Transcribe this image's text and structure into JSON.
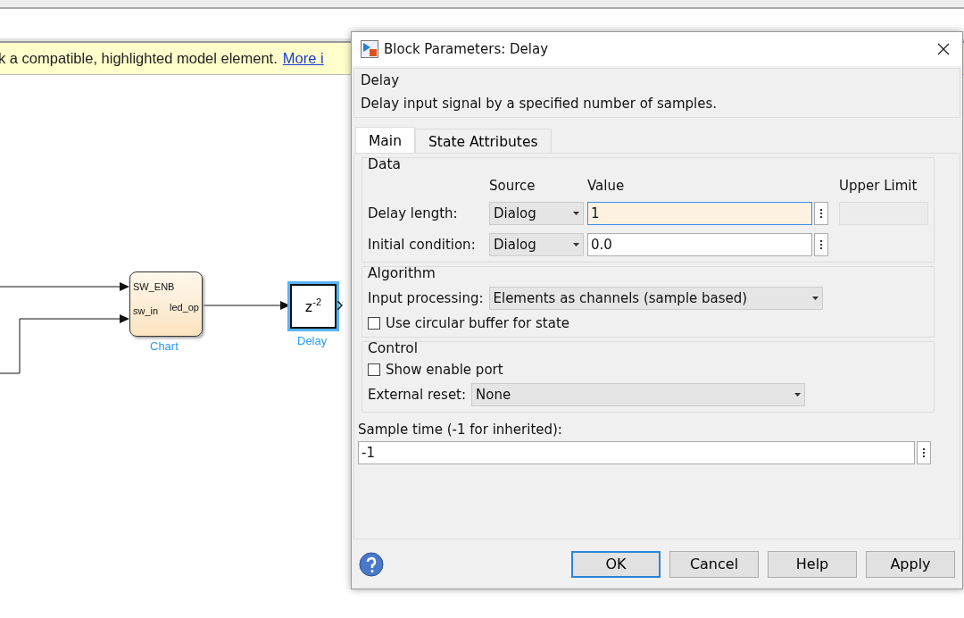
{
  "info_bar": {
    "text": "k a compatible, highlighted model element.",
    "link": "More i"
  },
  "diagram": {
    "chart": {
      "label": "Chart",
      "inputs": [
        "SW_ENB",
        "sw_in"
      ],
      "output": "led_op"
    },
    "delay": {
      "label": "Delay",
      "base": "z",
      "exponent": "-2",
      "selected": true
    }
  },
  "dialog": {
    "title": "Block Parameters: Delay",
    "block_type": "Delay",
    "description": "Delay input signal by a specified number of samples.",
    "tabs": [
      {
        "label": "Main",
        "selected": true
      },
      {
        "label": "State Attributes",
        "selected": false
      }
    ],
    "data_group": {
      "title": "Data",
      "headers": [
        "Source",
        "Value",
        "Upper Limit"
      ],
      "rows": [
        {
          "label": "Delay length:",
          "source": "Dialog",
          "value": "1",
          "focused": true,
          "upper_limit": true
        },
        {
          "label": "Initial condition:",
          "source": "Dialog",
          "value": "0.0",
          "focused": false
        }
      ]
    },
    "algorithm_group": {
      "title": "Algorithm",
      "items": [
        {
          "kind": "select",
          "label": "Input processing:",
          "value": "Elements as channels (sample based)"
        },
        {
          "kind": "checkbox",
          "label": "Use circular buffer for state",
          "checked": false
        }
      ]
    },
    "control_group": {
      "title": "Control",
      "items": [
        {
          "kind": "checkbox",
          "label": "Show enable port",
          "checked": false
        },
        {
          "kind": "select",
          "label": "External reset:",
          "value": "None"
        }
      ]
    },
    "sample_time": {
      "label": "Sample time (-1 for inherited):",
      "value": "-1"
    },
    "buttons": [
      {
        "label": "OK",
        "default": true
      },
      {
        "label": "Cancel",
        "default": false
      },
      {
        "label": "Help",
        "default": false
      },
      {
        "label": "Apply",
        "default": false
      }
    ]
  }
}
